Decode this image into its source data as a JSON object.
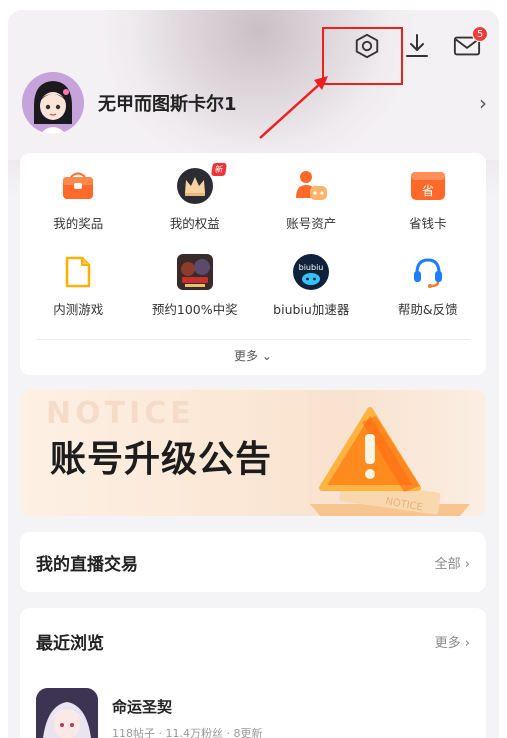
{
  "header": {
    "icons": [
      "settings-icon",
      "download-icon",
      "mail-icon"
    ],
    "mail_badge": "5"
  },
  "profile": {
    "username": "无甲而图斯卡尔1"
  },
  "services": {
    "items": [
      {
        "label": "我的奖品",
        "icon": "gift-box-icon"
      },
      {
        "label": "我的权益",
        "icon": "crown-icon",
        "tag": "新"
      },
      {
        "label": "账号资产",
        "icon": "account-assets-icon"
      },
      {
        "label": "省钱卡",
        "icon": "savings-card-icon",
        "card_text": "省"
      },
      {
        "label": "内测游戏",
        "icon": "beta-game-icon"
      },
      {
        "label": "预约100%中奖",
        "icon": "reservation-game-icon"
      },
      {
        "label": "biubiu加速器",
        "icon": "biubiu-accelerator-icon",
        "icon_text": "biubiu"
      },
      {
        "label": "帮助&反馈",
        "icon": "headset-icon"
      }
    ],
    "more_label": "更多"
  },
  "banner": {
    "ghost_text": "NOTICE",
    "title": "账号升级公告",
    "sign_text": "NOTICE"
  },
  "live_trade": {
    "title": "我的直播交易",
    "link": "全部 ›"
  },
  "recent": {
    "title": "最近浏览",
    "link": "更多 ›",
    "items": [
      {
        "name": "命运圣契",
        "stats": "118帖子 · 11.4万粉丝 · 8更新"
      }
    ]
  },
  "colors": {
    "accent_orange": "#ff6a2a",
    "annotation_red": "#ee1f1f",
    "badge_red": "#f33a3a"
  }
}
